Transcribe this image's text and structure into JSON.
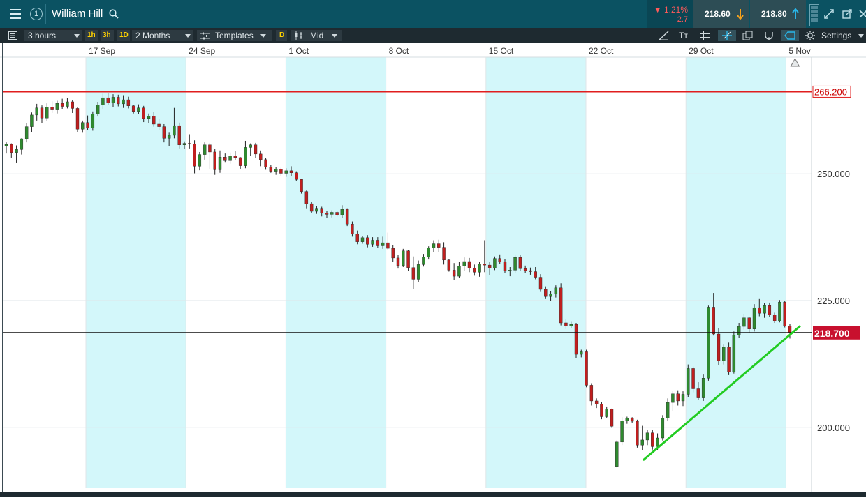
{
  "header": {
    "watchlist_number": "1",
    "instrument": "William Hill",
    "change_percent": "▼ 1.21%",
    "change_abs": "2.7",
    "sell_price": "218.60",
    "buy_price": "218.80"
  },
  "toolbar": {
    "interval": "3 hours",
    "quick_1h": "1h",
    "quick_3h": "3h",
    "quick_1d": "1D",
    "range": "2 Months",
    "templates": "Templates",
    "d_badge": "D",
    "price_type": "Mid",
    "settings": "Settings"
  },
  "chart_data": {
    "type": "candlestick",
    "x_labels": [
      "17 Sep",
      "24 Sep",
      "1 Oct",
      "8 Oct",
      "15 Oct",
      "22 Oct",
      "29 Oct",
      "5 Nov"
    ],
    "y_ticks": [
      "250.000",
      "225.000",
      "200.000"
    ],
    "ylim": [
      188.0,
      273.0
    ],
    "horizontal_line": {
      "value": 266.2,
      "label": "266.200",
      "color": "#e01e1e"
    },
    "current_price": {
      "value": 218.7,
      "label": "218.700",
      "color": "#c8102e"
    },
    "trend_line": {
      "from": [
        "26 Oct",
        193.5
      ],
      "to": [
        "6 Nov",
        220.0
      ],
      "color": "#22cc22"
    },
    "up_color": "#2f8a2f",
    "down_color": "#c01f1f",
    "shaded_weeks": [
      "17 Sep",
      "1 Oct",
      "15 Oct",
      "29 Oct"
    ],
    "shade_color": "#d3f7fa",
    "candles_ohlc": [
      [
        255.5,
        256.2,
        254.0,
        255.8
      ],
      [
        255.8,
        256.0,
        253.2,
        254.2
      ],
      [
        254.2,
        255.6,
        252.1,
        254.8
      ],
      [
        254.8,
        257.0,
        253.8,
        256.9
      ],
      [
        256.9,
        260.0,
        256.2,
        259.3
      ],
      [
        259.3,
        262.1,
        258.2,
        261.6
      ],
      [
        261.6,
        263.8,
        260.5,
        263.0
      ],
      [
        263.0,
        263.5,
        260.0,
        261.0
      ],
      [
        261.0,
        263.9,
        260.4,
        263.2
      ],
      [
        263.2,
        264.3,
        262.0,
        262.6
      ],
      [
        262.6,
        264.4,
        261.9,
        263.9
      ],
      [
        263.9,
        264.8,
        262.8,
        263.3
      ],
      [
        263.3,
        264.9,
        262.9,
        264.2
      ],
      [
        264.2,
        264.6,
        262.0,
        262.9
      ],
      [
        262.9,
        263.1,
        258.2,
        258.8
      ],
      [
        258.8,
        260.5,
        258.1,
        260.1
      ],
      [
        260.1,
        261.5,
        258.6,
        259.0
      ],
      [
        259.0,
        262.3,
        258.5,
        261.8
      ],
      [
        261.8,
        264.2,
        261.3,
        263.6
      ],
      [
        263.6,
        265.8,
        262.7,
        265.0
      ],
      [
        265.0,
        265.9,
        263.6,
        264.0
      ],
      [
        264.0,
        265.7,
        263.2,
        265.1
      ],
      [
        265.1,
        265.6,
        263.3,
        263.8
      ],
      [
        263.8,
        265.5,
        263.0,
        264.6
      ],
      [
        264.6,
        265.2,
        262.9,
        263.4
      ],
      [
        263.4,
        263.6,
        261.9,
        262.3
      ],
      [
        262.3,
        263.7,
        261.8,
        263.0
      ],
      [
        263.0,
        263.4,
        260.2,
        260.9
      ],
      [
        260.9,
        261.9,
        260.0,
        261.4
      ],
      [
        261.4,
        262.2,
        259.3,
        259.8
      ],
      [
        259.8,
        260.9,
        258.7,
        259.3
      ],
      [
        259.3,
        259.8,
        256.2,
        257.0
      ],
      [
        257.0,
        258.1,
        255.5,
        257.6
      ],
      [
        257.6,
        263.0,
        257.0,
        259.5
      ],
      [
        259.5,
        260.1,
        255.0,
        255.7
      ],
      [
        255.7,
        256.4,
        254.9,
        256.0
      ],
      [
        256.0,
        257.8,
        255.0,
        255.9
      ],
      [
        255.9,
        256.6,
        250.1,
        251.5
      ],
      [
        251.5,
        254.3,
        250.7,
        253.8
      ],
      [
        253.8,
        256.2,
        252.8,
        255.7
      ],
      [
        255.7,
        256.1,
        251.0,
        254.3
      ],
      [
        254.3,
        254.9,
        249.8,
        250.8
      ],
      [
        250.8,
        254.6,
        250.2,
        253.3
      ],
      [
        253.3,
        254.0,
        252.2,
        252.6
      ],
      [
        252.6,
        254.2,
        252.0,
        253.5
      ],
      [
        253.5,
        254.5,
        252.7,
        253.2
      ],
      [
        253.2,
        253.3,
        251.0,
        251.6
      ],
      [
        251.6,
        256.5,
        251.1,
        255.2
      ],
      [
        255.2,
        256.0,
        253.6,
        255.7
      ],
      [
        255.7,
        256.1,
        253.1,
        253.9
      ],
      [
        253.9,
        254.6,
        251.5,
        252.8
      ],
      [
        252.8,
        253.1,
        250.8,
        251.3
      ],
      [
        251.3,
        251.8,
        250.2,
        250.5
      ],
      [
        250.5,
        251.4,
        249.8,
        250.9
      ],
      [
        250.9,
        251.2,
        249.6,
        250.1
      ],
      [
        250.1,
        251.1,
        249.4,
        250.6
      ],
      [
        250.6,
        251.5,
        249.5,
        250.2
      ],
      [
        250.2,
        250.5,
        248.6,
        248.9
      ],
      [
        248.9,
        249.0,
        246.1,
        246.5
      ],
      [
        246.5,
        246.7,
        243.2,
        244.1
      ],
      [
        244.1,
        244.4,
        242.2,
        242.6
      ],
      [
        242.6,
        243.6,
        242.1,
        243.2
      ],
      [
        243.2,
        243.5,
        241.6,
        242.3
      ],
      [
        242.3,
        242.6,
        241.3,
        242.0
      ],
      [
        242.0,
        242.8,
        241.4,
        242.4
      ],
      [
        242.4,
        242.6,
        241.6,
        241.9
      ],
      [
        241.9,
        243.8,
        241.3,
        243.0
      ],
      [
        243.0,
        243.2,
        239.7,
        240.1
      ],
      [
        240.1,
        240.6,
        237.6,
        238.1
      ],
      [
        238.1,
        238.8,
        236.1,
        236.6
      ],
      [
        236.6,
        237.7,
        236.2,
        237.4
      ],
      [
        237.4,
        237.9,
        235.5,
        236.1
      ],
      [
        236.1,
        237.5,
        235.6,
        236.9
      ],
      [
        236.9,
        237.5,
        235.4,
        235.8
      ],
      [
        235.8,
        237.6,
        235.2,
        236.4
      ],
      [
        236.4,
        238.4,
        234.9,
        235.3
      ],
      [
        235.3,
        236.0,
        232.6,
        233.4
      ],
      [
        233.4,
        234.0,
        231.3,
        231.9
      ],
      [
        231.9,
        235.2,
        231.6,
        234.8
      ],
      [
        234.8,
        235.0,
        230.9,
        231.5
      ],
      [
        231.5,
        233.7,
        227.2,
        229.2
      ],
      [
        229.2,
        232.9,
        228.7,
        232.1
      ],
      [
        232.1,
        234.2,
        231.7,
        233.6
      ],
      [
        233.6,
        235.7,
        233.1,
        235.4
      ],
      [
        235.4,
        236.9,
        234.6,
        236.2
      ],
      [
        236.2,
        237.0,
        234.5,
        235.5
      ],
      [
        235.5,
        236.5,
        232.1,
        233.0
      ],
      [
        233.0,
        233.1,
        230.7,
        231.0
      ],
      [
        231.0,
        232.4,
        229.0,
        229.8
      ],
      [
        229.8,
        232.7,
        229.4,
        231.8
      ],
      [
        231.8,
        233.5,
        230.9,
        232.7
      ],
      [
        232.7,
        233.4,
        230.6,
        231.4
      ],
      [
        231.4,
        232.1,
        229.9,
        230.6
      ],
      [
        230.6,
        232.7,
        229.7,
        232.2
      ],
      [
        232.2,
        236.9,
        230.6,
        232.0
      ],
      [
        232.0,
        232.7,
        230.0,
        231.4
      ],
      [
        231.4,
        233.7,
        231.0,
        233.3
      ],
      [
        233.3,
        234.1,
        232.2,
        232.6
      ],
      [
        232.6,
        233.2,
        230.4,
        230.8
      ],
      [
        230.8,
        231.6,
        229.8,
        231.0
      ],
      [
        231.0,
        233.9,
        230.5,
        233.5
      ],
      [
        233.5,
        234.0,
        230.8,
        231.3
      ],
      [
        231.3,
        231.9,
        230.4,
        230.9
      ],
      [
        230.9,
        231.5,
        230.1,
        230.7
      ],
      [
        230.7,
        231.6,
        229.2,
        229.6
      ],
      [
        229.6,
        230.2,
        226.7,
        227.2
      ],
      [
        227.2,
        227.8,
        225.3,
        225.8
      ],
      [
        225.8,
        226.8,
        224.9,
        226.3
      ],
      [
        226.3,
        228.0,
        225.6,
        227.5
      ],
      [
        227.5,
        228.4,
        220.1,
        220.6
      ],
      [
        220.6,
        221.4,
        219.4,
        220.0
      ],
      [
        220.0,
        220.8,
        219.6,
        220.3
      ],
      [
        220.3,
        220.6,
        213.6,
        214.4
      ],
      [
        214.4,
        215.3,
        213.8,
        214.9
      ],
      [
        214.9,
        215.3,
        207.9,
        208.3
      ],
      [
        208.3,
        208.7,
        204.3,
        205.2
      ],
      [
        205.2,
        205.7,
        203.8,
        204.6
      ],
      [
        204.6,
        205.0,
        201.6,
        202.1
      ],
      [
        202.1,
        204.1,
        201.8,
        203.6
      ],
      [
        203.6,
        203.7,
        199.9,
        200.2
      ],
      [
        192.3,
        197.4,
        192.1,
        197.1
      ],
      [
        197.1,
        202.0,
        196.5,
        201.3
      ],
      [
        201.3,
        202.1,
        200.7,
        201.8
      ],
      [
        201.8,
        202.0,
        200.8,
        201.2
      ],
      [
        201.2,
        201.5,
        196.0,
        196.5
      ],
      [
        196.5,
        200.3,
        195.5,
        197.5
      ],
      [
        197.5,
        199.5,
        196.5,
        198.9
      ],
      [
        198.9,
        199.5,
        195.6,
        196.2
      ],
      [
        196.2,
        198.8,
        195.5,
        197.9
      ],
      [
        197.9,
        202.4,
        197.4,
        201.8
      ],
      [
        201.8,
        205.7,
        201.2,
        204.9
      ],
      [
        204.9,
        207.2,
        203.2,
        206.6
      ],
      [
        206.6,
        207.3,
        204.3,
        205.2
      ],
      [
        205.2,
        207.1,
        204.2,
        206.5
      ],
      [
        206.5,
        212.4,
        205.9,
        211.6
      ],
      [
        211.6,
        212.0,
        206.9,
        207.6
      ],
      [
        207.6,
        208.9,
        205.4,
        205.8
      ],
      [
        205.8,
        210.4,
        205.2,
        209.7
      ],
      [
        209.7,
        224.0,
        209.2,
        223.7
      ],
      [
        223.7,
        226.5,
        218.1,
        218.4
      ],
      [
        218.4,
        219.6,
        212.2,
        213.1
      ],
      [
        213.1,
        216.3,
        212.4,
        215.8
      ],
      [
        215.8,
        216.7,
        210.3,
        210.9
      ],
      [
        210.9,
        218.9,
        210.6,
        218.2
      ],
      [
        218.2,
        220.6,
        217.7,
        219.9
      ],
      [
        219.9,
        222.4,
        219.3,
        221.6
      ],
      [
        221.6,
        221.8,
        218.7,
        219.4
      ],
      [
        219.4,
        224.3,
        218.9,
        223.6
      ],
      [
        223.6,
        225.3,
        221.9,
        222.5
      ],
      [
        222.5,
        224.5,
        221.6,
        224.0
      ],
      [
        224.0,
        224.6,
        221.7,
        222.2
      ],
      [
        222.2,
        222.6,
        220.6,
        221.0
      ],
      [
        221.0,
        225.1,
        220.7,
        224.7
      ],
      [
        224.7,
        224.9,
        219.7,
        220.0
      ],
      [
        220.0,
        220.4,
        217.5,
        218.7
      ]
    ]
  }
}
